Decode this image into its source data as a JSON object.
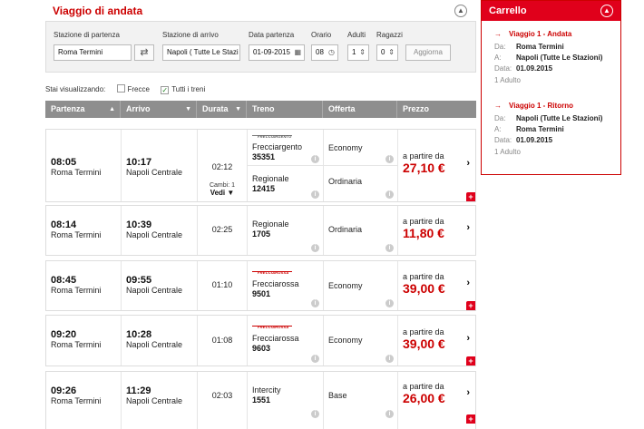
{
  "search": {
    "title": "Viaggio di andata",
    "labels": {
      "from": "Stazione di partenza",
      "to": "Stazione di arrivo",
      "date": "Data partenza",
      "time": "Orario",
      "adults": "Adulti",
      "kids": "Ragazzi"
    },
    "values": {
      "from": "Roma Termini",
      "to": "Napoli ( Tutte Le Stazi",
      "date": "01-09-2015",
      "time": "08",
      "adults": "1",
      "kids": "0"
    },
    "search_button": "Aggiorna"
  },
  "filters": {
    "label": "Stai visualizzando:",
    "frecce": "Frecce",
    "tutti": "Tutti i treni",
    "tutti_checked": true
  },
  "columns": [
    "Partenza",
    "Arrivo",
    "Durata",
    "Treno",
    "Offerta",
    "Prezzo"
  ],
  "rows": [
    {
      "dep_time": "08:05",
      "dep_station": "Roma Termini",
      "arr_time": "10:17",
      "arr_station": "Napoli Centrale",
      "duration": "02:12",
      "changes": "Cambi: 1",
      "details": "Vedi",
      "segments": [
        {
          "train": "Frecciargento",
          "number": "35351",
          "offer": "Economy",
          "logo": "FRECCIARGENTO"
        },
        {
          "train": "Regionale",
          "number": "12415",
          "offer": "Ordinaria"
        }
      ],
      "price_prefix": "a partire da",
      "price": "27,10 €"
    },
    {
      "dep_time": "08:14",
      "dep_station": "Roma Termini",
      "arr_time": "10:39",
      "arr_station": "Napoli Centrale",
      "duration": "02:25",
      "segments": [
        {
          "train": "Regionale",
          "number": "1705",
          "offer": "Ordinaria"
        }
      ],
      "price_prefix": "a partire da",
      "price": "11,80 €"
    },
    {
      "dep_time": "08:45",
      "dep_station": "Roma Termini",
      "arr_time": "09:55",
      "arr_station": "Napoli Centrale",
      "duration": "01:10",
      "segments": [
        {
          "train": "Frecciarossa",
          "number": "9501",
          "offer": "Economy",
          "logo": "FRECCIAROSSA"
        }
      ],
      "price_prefix": "a partire da",
      "price": "39,00 €"
    },
    {
      "dep_time": "09:20",
      "dep_station": "Roma Termini",
      "arr_time": "10:28",
      "arr_station": "Napoli Centrale",
      "duration": "01:08",
      "segments": [
        {
          "train": "Frecciarossa",
          "number": "9603",
          "offer": "Economy",
          "logo": "FRECCIAROSSA"
        }
      ],
      "price_prefix": "a partire da",
      "price": "39,00 €"
    },
    {
      "dep_time": "09:26",
      "dep_station": "Roma Termini",
      "arr_time": "11:29",
      "arr_station": "Napoli Centrale",
      "duration": "02:03",
      "segments": [
        {
          "train": "Intercity",
          "number": "1551",
          "offer": "Base"
        }
      ],
      "price_prefix": "a partire da",
      "price": "26,00 €"
    }
  ],
  "cart": {
    "title": "Carrello",
    "trips": [
      {
        "title": "Viaggio 1 - Andata",
        "from_label": "Da:",
        "from": "Roma Termini",
        "to_label": "A:",
        "to": "Napoli (Tutte Le Stazioni)",
        "date_label": "Data:",
        "date": "01.09.2015",
        "adults": "1",
        "adults_label": "Adulto"
      },
      {
        "title": "Viaggio 1 - Ritorno",
        "from_label": "Da:",
        "from": "Napoli (Tutte Le Stazioni)",
        "to_label": "A:",
        "to": "Roma Termini",
        "date_label": "Data:",
        "date": "01.09.2015",
        "adults": "1",
        "adults_label": "Adulto"
      }
    ]
  },
  "colors": {
    "brand_red": "#cc0000",
    "header_gray": "#8e8e8e",
    "cart_red": "#e0001b"
  }
}
